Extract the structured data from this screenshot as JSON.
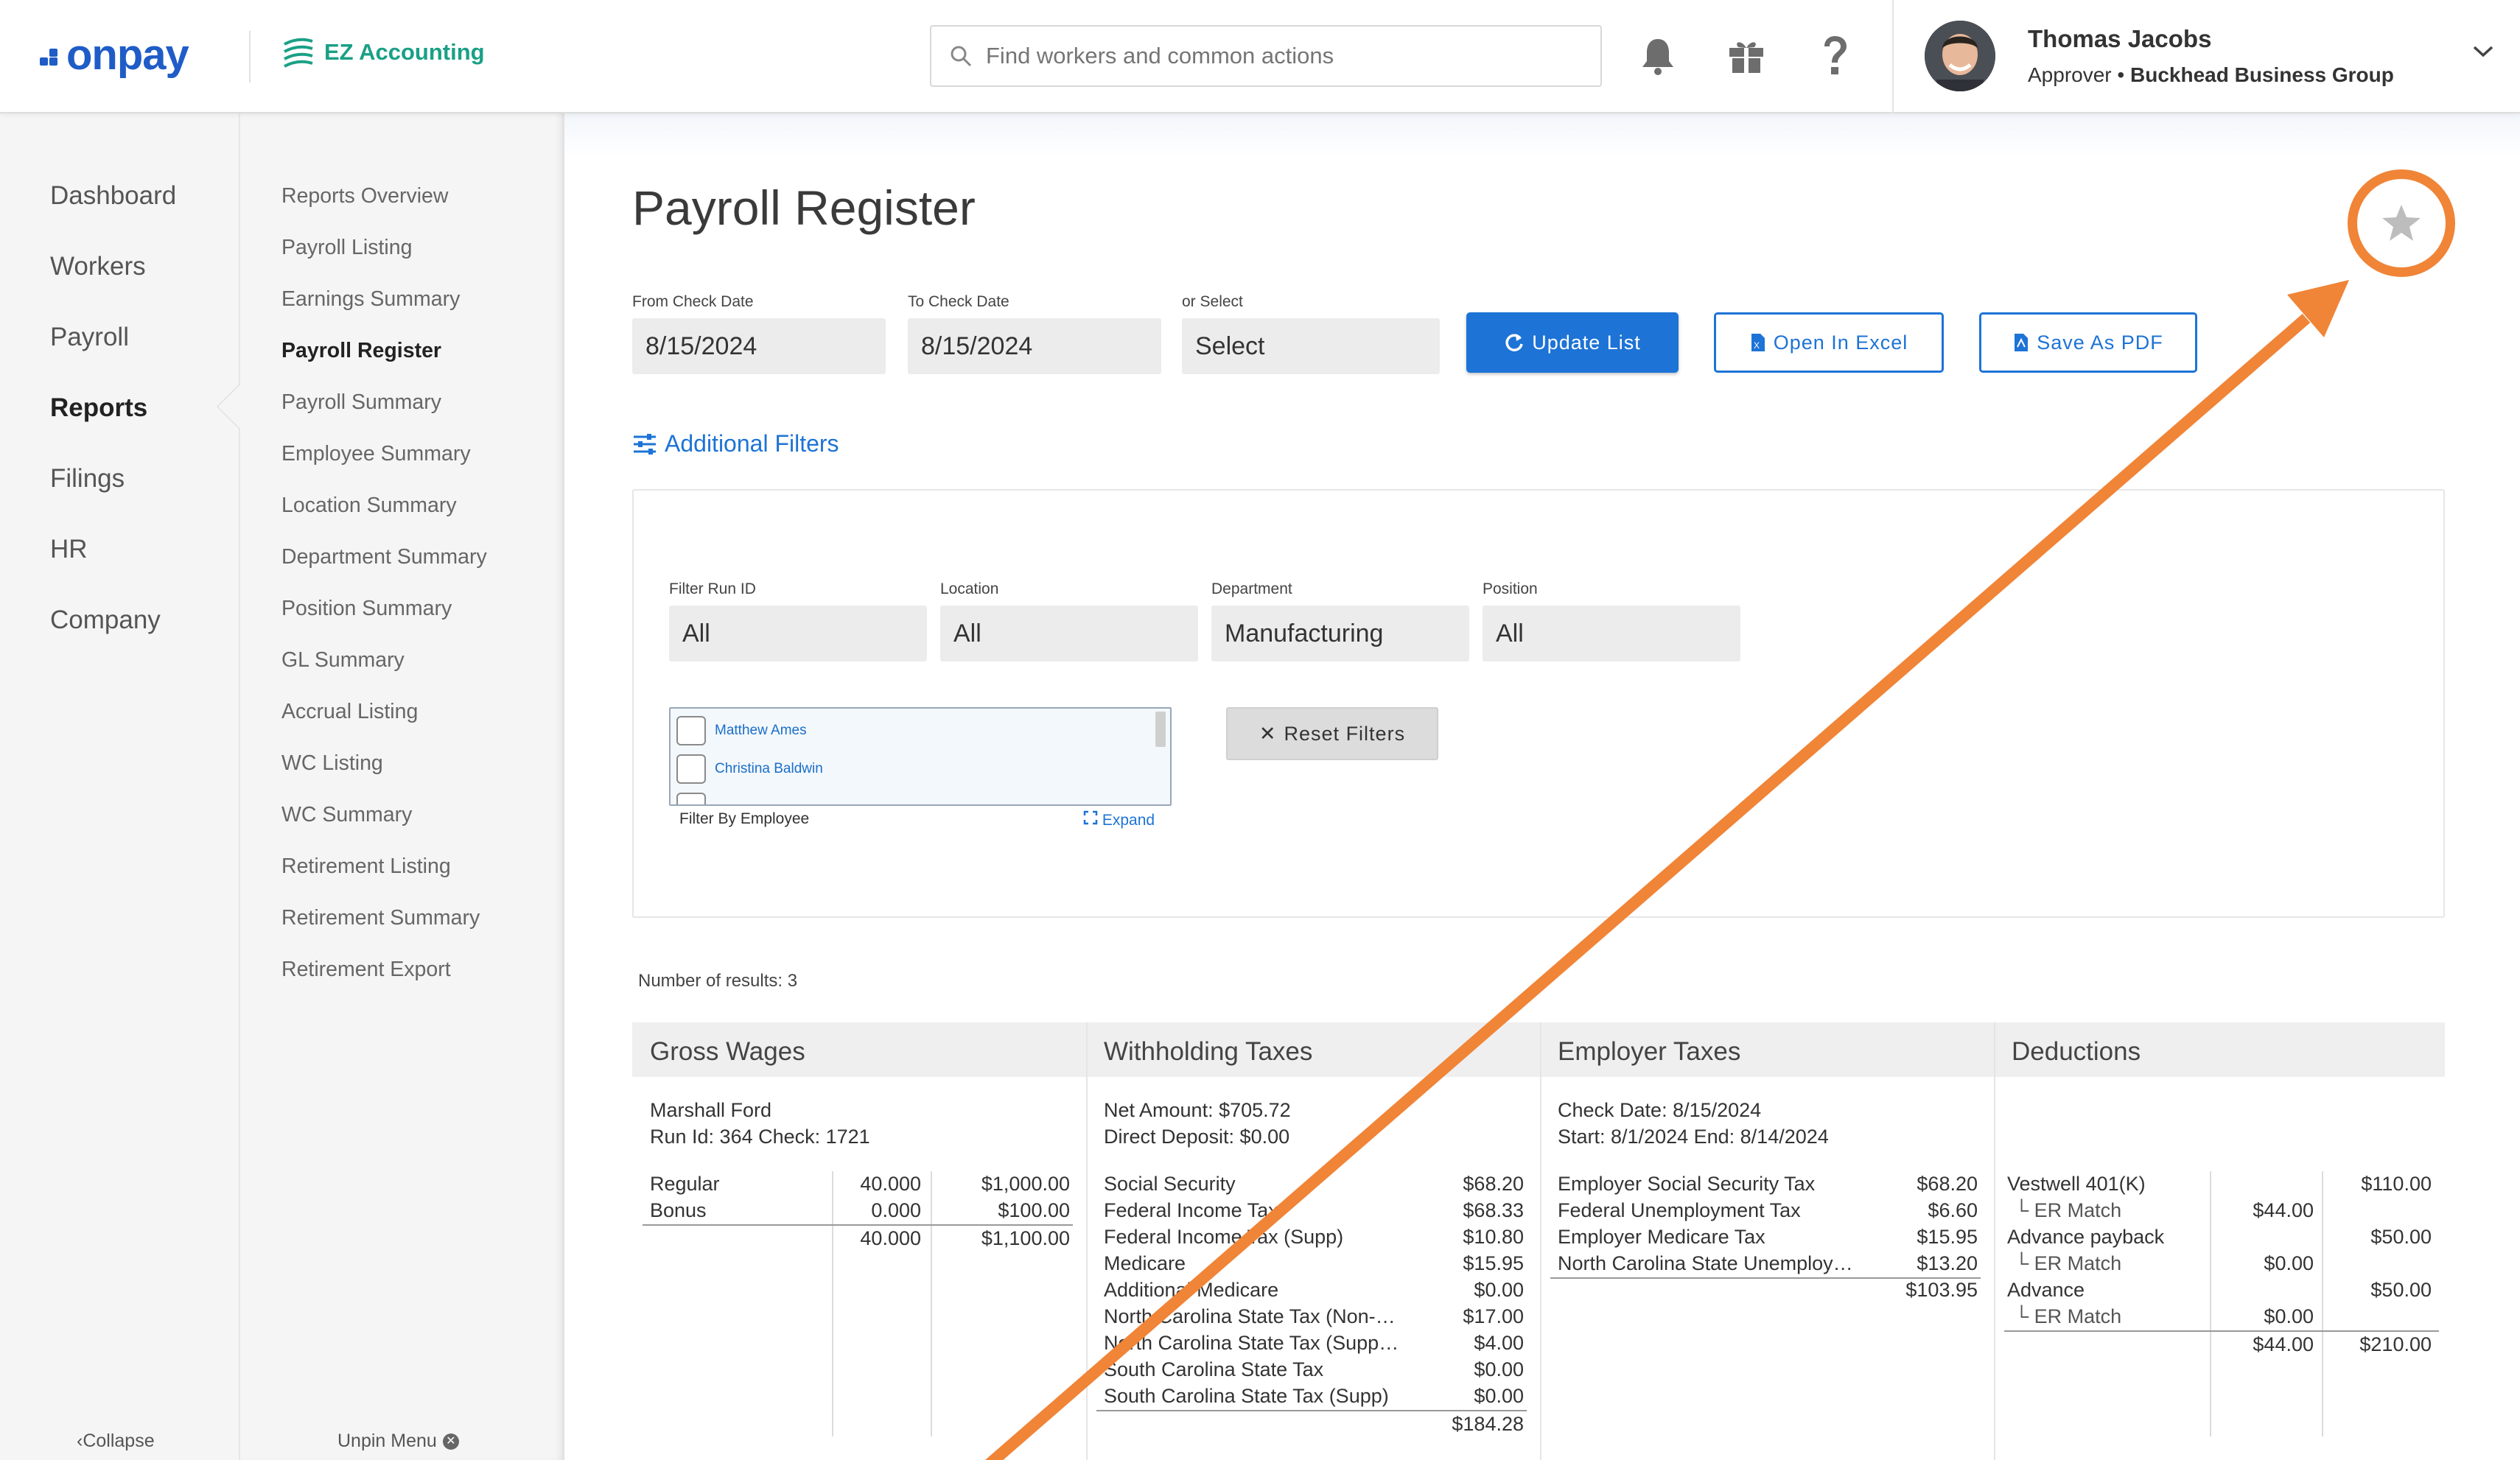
{
  "header": {
    "brand": "onpay",
    "app_name": "EZ Accounting",
    "search_placeholder": "Find workers and common actions",
    "user_name": "Thomas Jacobs",
    "user_role": "Approver",
    "user_company": "Buckhead Business Group"
  },
  "nav": {
    "items": [
      "Dashboard",
      "Workers",
      "Payroll",
      "Reports",
      "Filings",
      "HR",
      "Company"
    ],
    "active": "Reports",
    "collapse_label": "Collapse"
  },
  "subnav": {
    "items": [
      "Reports Overview",
      "Payroll Listing",
      "Earnings Summary",
      "Payroll Register",
      "Payroll Summary",
      "Employee Summary",
      "Location Summary",
      "Department Summary",
      "Position Summary",
      "GL Summary",
      "Accrual Listing",
      "WC Listing",
      "WC Summary",
      "Retirement Listing",
      "Retirement Summary",
      "Retirement Export"
    ],
    "active": "Payroll Register",
    "unpin_label": "Unpin Menu"
  },
  "page": {
    "title": "Payroll Register",
    "from_label": "From Check Date",
    "from_value": "8/15/2024",
    "to_label": "To Check Date",
    "to_value": "8/15/2024",
    "select_label": "or Select",
    "select_value": "Select",
    "update_label": "Update List",
    "excel_label": "Open In Excel",
    "pdf_label": "Save As PDF",
    "additional_filters": "Additional Filters"
  },
  "filters": {
    "run_label": "Filter Run ID",
    "run_value": "All",
    "location_label": "Location",
    "location_value": "All",
    "department_label": "Department",
    "department_value": "Manufacturing",
    "position_label": "Position",
    "position_value": "All",
    "employees": [
      "Matthew Ames",
      "Christina Baldwin"
    ],
    "employee_caption": "Filter By Employee",
    "expand_label": "Expand",
    "reset_label": "Reset Filters"
  },
  "results": {
    "count_label": "Number of results: 3",
    "headers": [
      "Gross Wages",
      "Withholding Taxes",
      "Employer Taxes",
      "Deductions"
    ],
    "employee": "Marshall Ford",
    "run_info": "Run Id: 364 Check: 1721",
    "net_amount": "Net Amount: $705.72",
    "direct_deposit": "Direct Deposit: $0.00",
    "check_date": "Check Date: 8/15/2024",
    "period": "Start: 8/1/2024   End: 8/14/2024",
    "wages": [
      {
        "name": "Regular",
        "hours": "40.000",
        "amount": "$1,000.00"
      },
      {
        "name": "Bonus",
        "hours": "0.000",
        "amount": "$100.00"
      }
    ],
    "wages_total_hours": "40.000",
    "wages_total": "$1,100.00",
    "withholding": [
      {
        "name": "Social Security",
        "amount": "$68.20"
      },
      {
        "name": "Federal Income Tax",
        "amount": "$68.33"
      },
      {
        "name": "Federal Income Tax (Supp)",
        "amount": "$10.80"
      },
      {
        "name": "Medicare",
        "amount": "$15.95"
      },
      {
        "name": "Additional Medicare",
        "amount": "$0.00"
      },
      {
        "name": "North Carolina State Tax (Non-…",
        "amount": "$17.00"
      },
      {
        "name": "North Carolina State Tax (Supp…",
        "amount": "$4.00"
      },
      {
        "name": "South Carolina State Tax",
        "amount": "$0.00"
      },
      {
        "name": "South Carolina State Tax (Supp)",
        "amount": "$0.00"
      }
    ],
    "withholding_total": "$184.28",
    "employer_taxes": [
      {
        "name": "Employer Social Security Tax",
        "amount": "$68.20"
      },
      {
        "name": "Federal Unemployment Tax",
        "amount": "$6.60"
      },
      {
        "name": "Employer Medicare Tax",
        "amount": "$15.95"
      },
      {
        "name": "North Carolina State Unemploy…",
        "amount": "$13.20"
      }
    ],
    "employer_total": "$103.95",
    "deductions": [
      {
        "name": "Vestwell 401(K)",
        "er": "",
        "amount": "$110.00"
      },
      {
        "name": "└ ER Match",
        "er": "$44.00",
        "amount": ""
      },
      {
        "name": "Advance payback",
        "er": "",
        "amount": "$50.00"
      },
      {
        "name": "└ ER Match",
        "er": "$0.00",
        "amount": ""
      },
      {
        "name": "Advance",
        "er": "",
        "amount": "$50.00"
      },
      {
        "name": "└ ER Match",
        "er": "$0.00",
        "amount": ""
      }
    ],
    "deductions_er_total": "$44.00",
    "deductions_total": "$210.00"
  },
  "colors": {
    "accent": "#1d73d6",
    "annotation": "#f08437",
    "brand": "#1f5cc7",
    "ez": "#1aa086"
  }
}
